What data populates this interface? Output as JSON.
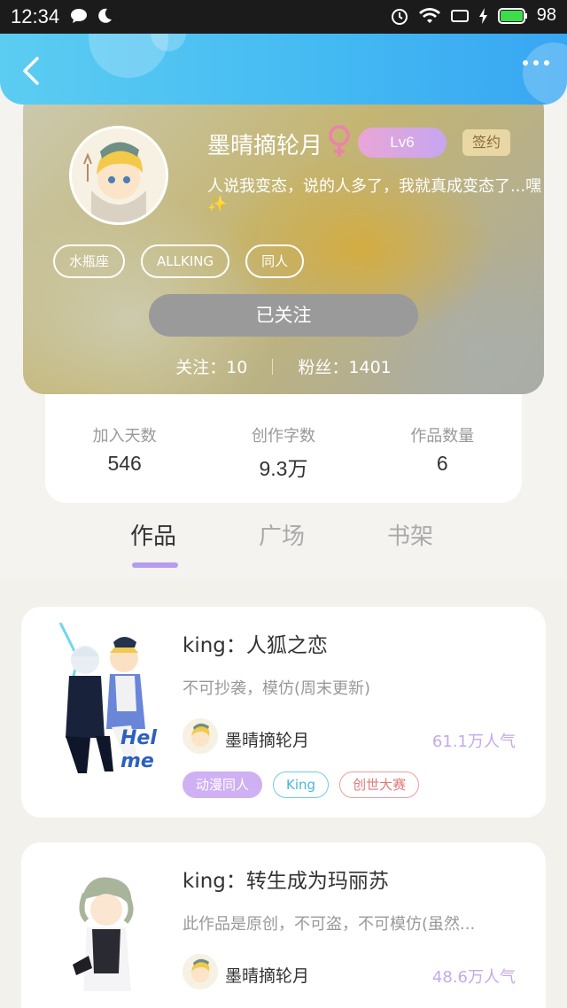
{
  "status_bar": {
    "time": "12:34",
    "battery": "98"
  },
  "profile": {
    "username": "墨晴摘轮月",
    "level": "Lv6",
    "sign_badge": "签约",
    "bio": "人说我变态，说的人多了，我就真成变态了...嘿",
    "tags": [
      "水瓶座",
      "ALLKING",
      "同人"
    ],
    "follow_button": "已关注",
    "following": "关注：10",
    "fans": "粉丝：1401"
  },
  "stats": [
    {
      "label": "加入天数",
      "value": "546"
    },
    {
      "label": "创作字数",
      "value": "9.3万"
    },
    {
      "label": "作品数量",
      "value": "6"
    }
  ],
  "tabs": [
    {
      "label": "作品",
      "active": true
    },
    {
      "label": "广场",
      "active": false
    },
    {
      "label": "书架",
      "active": false
    }
  ],
  "works": [
    {
      "title": "king：人狐之恋",
      "description": "不可抄袭，模仿(周末更新)",
      "author": "墨晴摘轮月",
      "popularity": "61.1万人气",
      "cover_text": "Hel me",
      "tags": [
        "动漫同人",
        "King",
        "创世大赛"
      ]
    },
    {
      "title": "king：转生成为玛丽苏",
      "description": "此作品是原创，不可盗，不可模仿(虽然...",
      "author": "墨晴摘轮月",
      "popularity": "48.6万人气"
    }
  ],
  "colors": {
    "accent": "#b49cf0",
    "header": "#43b9f3",
    "popularity": "#c6a8ee"
  },
  "icons": [
    "back-icon",
    "more-icon",
    "female-icon",
    "message-icon",
    "moon-icon",
    "alarm-icon",
    "wifi-icon",
    "screen-icon",
    "charging-icon",
    "battery-icon"
  ]
}
